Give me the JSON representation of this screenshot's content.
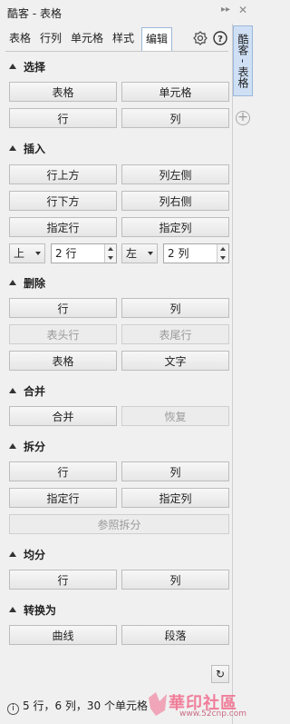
{
  "window": {
    "title": "酷客 - 表格"
  },
  "tabs": [
    "表格",
    "行列",
    "单元格",
    "样式",
    "编辑"
  ],
  "side_tab": "酷客 - 表格",
  "sections": {
    "select": {
      "title": "选择",
      "btns": [
        "表格",
        "单元格",
        "行",
        "列"
      ]
    },
    "insert": {
      "title": "插入",
      "btns": [
        "行上方",
        "列左侧",
        "行下方",
        "列右侧",
        "指定行",
        "指定列"
      ],
      "row_pos": "上",
      "row_count": "2 行",
      "col_pos": "左",
      "col_count": "2 列"
    },
    "delete": {
      "title": "删除",
      "btns": [
        "行",
        "列",
        "表头行",
        "表尾行",
        "表格",
        "文字"
      ]
    },
    "merge": {
      "title": "合并",
      "btns": [
        "合并",
        "恢复"
      ]
    },
    "split": {
      "title": "拆分",
      "btns": [
        "行",
        "列",
        "指定行",
        "指定列",
        "参照拆分"
      ]
    },
    "even": {
      "title": "均分",
      "btns": [
        "行",
        "列"
      ]
    },
    "convert": {
      "title": "转换为",
      "btns": [
        "曲线",
        "段落"
      ]
    }
  },
  "status": "5 行，6 列，30 个单元格",
  "watermark": {
    "text": "華印社區",
    "url": "www.52cnp.com"
  },
  "colors": {
    "accent": "#9bb7d8",
    "side_tab_bg": "#cfe0f5"
  }
}
